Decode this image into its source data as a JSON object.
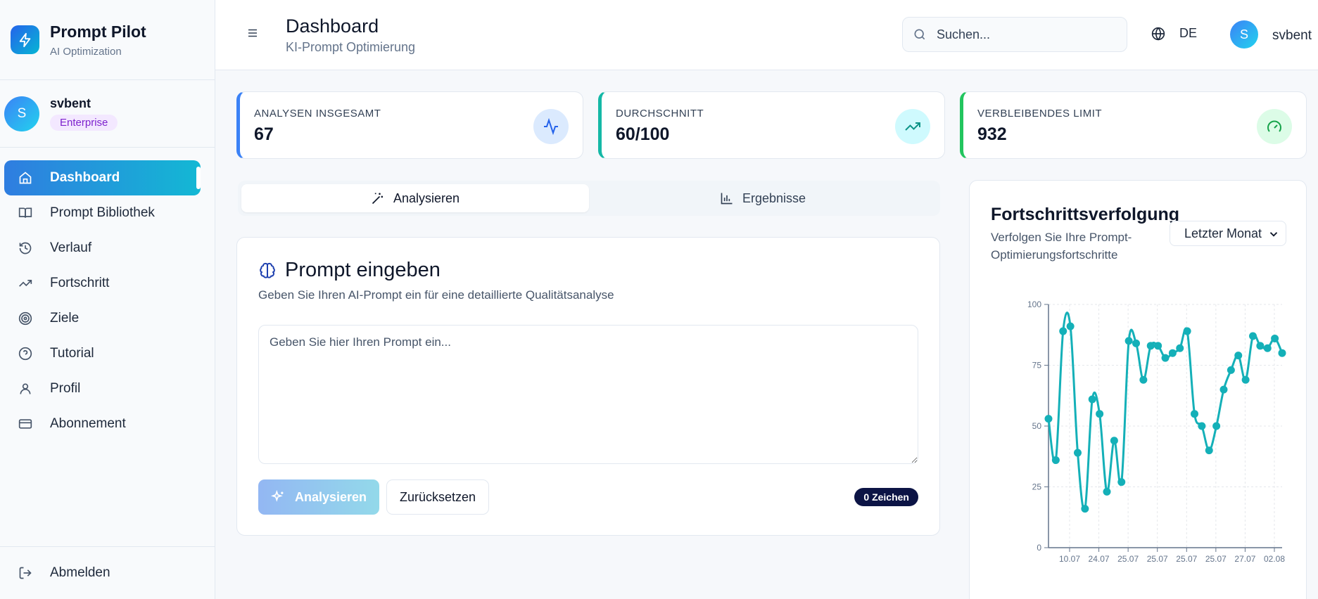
{
  "brand": {
    "title": "Prompt Pilot",
    "subtitle": "AI Optimization"
  },
  "user": {
    "initial": "S",
    "name": "svbent",
    "plan": "Enterprise"
  },
  "sidebar": {
    "items": [
      {
        "label": "Dashboard",
        "icon": "home-icon",
        "active": true
      },
      {
        "label": "Prompt Bibliothek",
        "icon": "book-icon"
      },
      {
        "label": "Verlauf",
        "icon": "history-icon"
      },
      {
        "label": "Fortschritt",
        "icon": "trending-up-icon"
      },
      {
        "label": "Ziele",
        "icon": "target-icon"
      },
      {
        "label": "Tutorial",
        "icon": "help-circle-icon"
      },
      {
        "label": "Profil",
        "icon": "user-icon"
      },
      {
        "label": "Abonnement",
        "icon": "credit-card-icon"
      }
    ],
    "logout_label": "Abmelden"
  },
  "header": {
    "title": "Dashboard",
    "subtitle": "KI-Prompt Optimierung",
    "search_placeholder": "Suchen...",
    "language": "DE",
    "user_initial": "S",
    "user_name": "svbent"
  },
  "stats": [
    {
      "label": "ANALYSEN INSGESAMT",
      "value": "67",
      "accent": "#3b82f6",
      "icon": "activity-icon"
    },
    {
      "label": "DURCHSCHNITT",
      "value": "60/100",
      "accent": "#14b8a6",
      "icon": "trending-up-icon"
    },
    {
      "label": "VERBLEIBENDES LIMIT",
      "value": "932",
      "accent": "#22c55e",
      "icon": "gauge-icon"
    }
  ],
  "tabs": [
    {
      "label": "Analysieren",
      "icon": "magic-wand-icon",
      "active": true
    },
    {
      "label": "Ergebnisse",
      "icon": "bar-chart-icon"
    }
  ],
  "prompt": {
    "title": "Prompt eingeben",
    "subtitle": "Geben Sie Ihren AI-Prompt ein für eine detaillierte Qualitätsanalyse",
    "placeholder": "Geben Sie hier Ihren Prompt ein...",
    "analyze_label": "Analysieren",
    "reset_label": "Zurücksetzen",
    "char_count": "0 Zeichen"
  },
  "progress": {
    "title": "Fortschrittsverfolgung",
    "subtitle": "Verfolgen Sie Ihre Prompt-Optimierungsfortschritte",
    "period": "Letzter Monat"
  },
  "colors": {
    "line": "#14b0b8",
    "primary": "#2f7de0"
  },
  "chart_data": {
    "type": "line",
    "ylim": [
      0,
      100
    ],
    "yticks": [
      0,
      25,
      50,
      75,
      100
    ],
    "xtick_labels": [
      "10.07",
      "24.07",
      "25.07",
      "25.07",
      "25.07",
      "25.07",
      "27.07",
      "02.08"
    ],
    "series": [
      {
        "values": [
          53,
          36,
          89,
          91,
          39,
          16,
          61,
          55,
          23,
          44,
          27,
          85,
          84,
          69,
          83,
          83,
          78,
          80,
          82,
          89,
          55,
          50,
          40,
          50,
          65,
          73,
          79,
          69,
          87,
          83,
          82,
          86,
          80
        ]
      }
    ],
    "grid": true
  }
}
